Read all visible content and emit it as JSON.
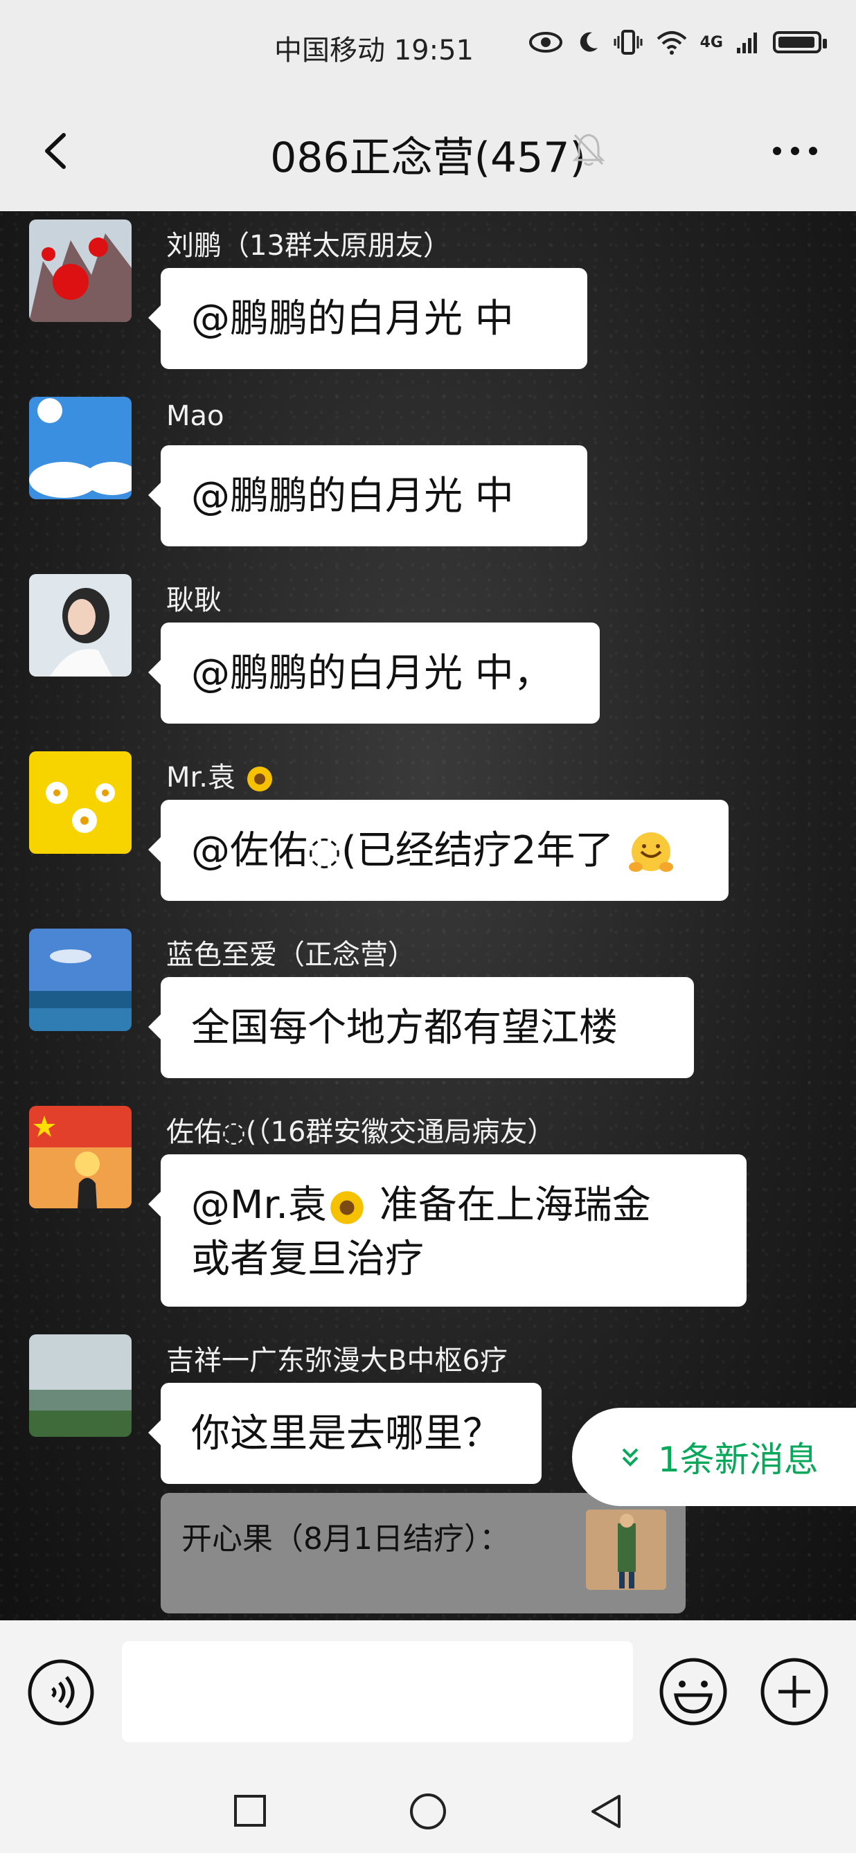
{
  "status_bar": {
    "carrier_time": "中国移动 19:51",
    "network": "4G"
  },
  "header": {
    "title": "086正念营(457)"
  },
  "messages": [
    {
      "sender": "刘鹏（13群太原朋友）",
      "text": "@鹏鹏的白月光  中"
    },
    {
      "sender": "Mao",
      "text": "@鹏鹏的白月光  中"
    },
    {
      "sender": "耿耿",
      "text": "@鹏鹏的白月光  中，"
    },
    {
      "sender": "Mr.袁",
      "text": "@佐佑◌(已经结疗2年了"
    },
    {
      "sender": "蓝色至爱（正念营）",
      "text": "全国每个地方都有望江楼"
    },
    {
      "sender": "佐佑◌(（16群安徽交通局病友）",
      "text_line1_a": "@Mr.袁",
      "text_line1_b": "  准备在上海瑞金",
      "text_line2": "或者复旦治疗"
    },
    {
      "sender": "吉祥一广东弥漫大B中枢6疗",
      "text": "你这里是去哪里？"
    }
  ],
  "quoted_card": {
    "text": "开心果（8月1日结疗）："
  },
  "new_message_pill": {
    "label": "1条新消息"
  },
  "input": {
    "value": ""
  },
  "colors": {
    "accent_green": "#07a85a",
    "header_bg": "#ededed",
    "bubble_bg": "#ffffff"
  },
  "icons": {
    "back": "back-arrow-icon",
    "mute": "muted-bell-icon",
    "more": "more-dots-icon",
    "voice": "voice-icon",
    "emoji": "emoji-icon",
    "plus": "plus-icon"
  }
}
